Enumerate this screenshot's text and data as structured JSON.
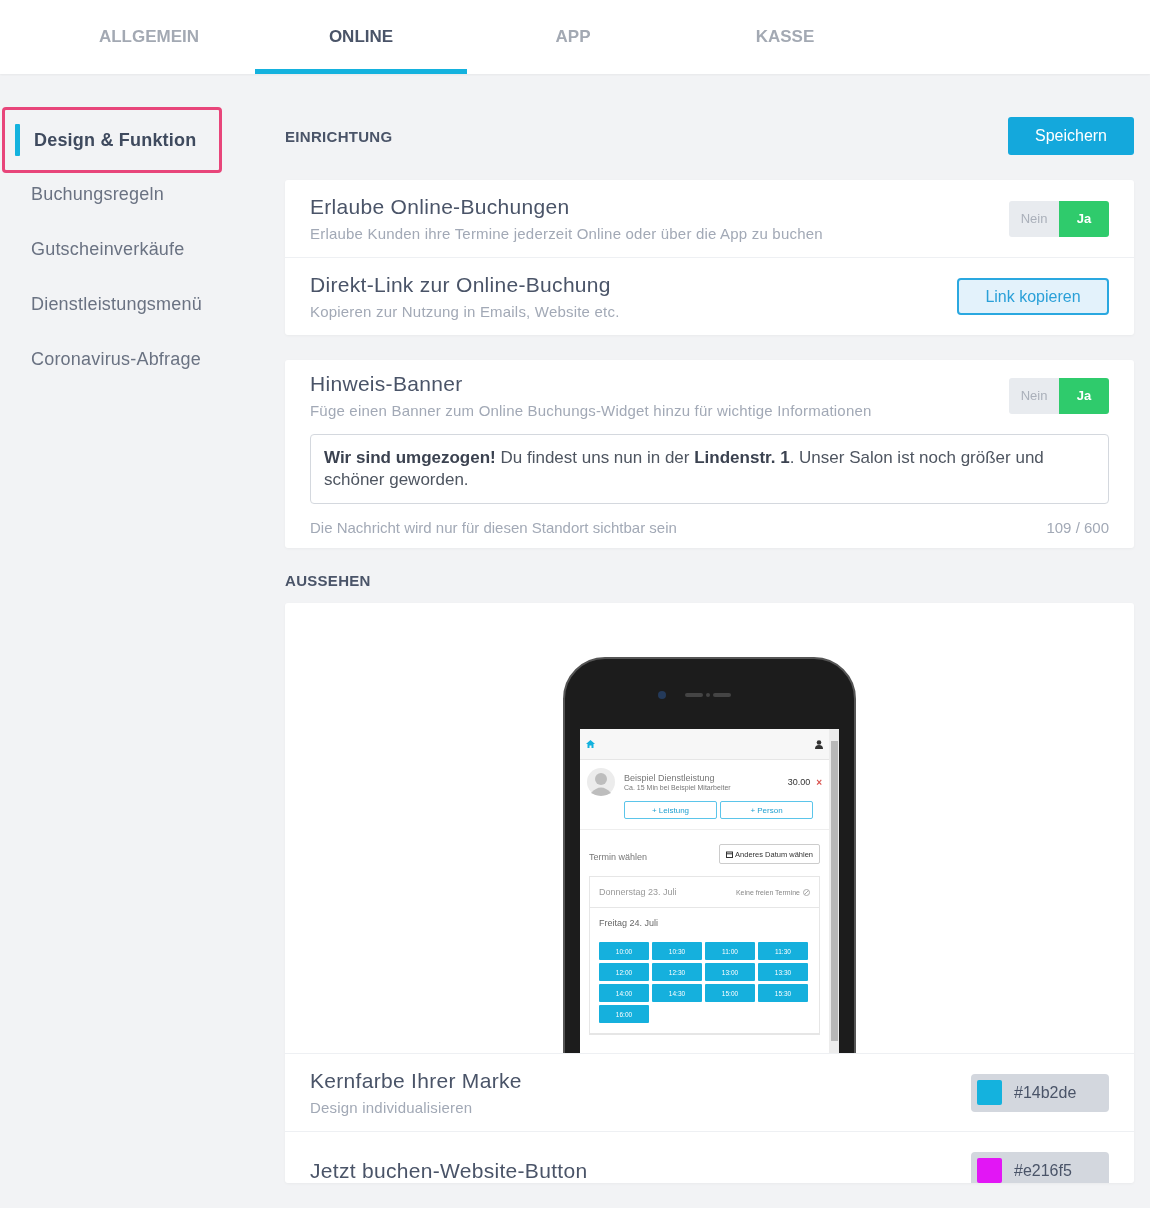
{
  "tabs": [
    {
      "label": "ALLGEMEIN",
      "selected": false
    },
    {
      "label": "ONLINE",
      "selected": true
    },
    {
      "label": "APP",
      "selected": false
    },
    {
      "label": "KASSE",
      "selected": false
    }
  ],
  "sidebar": {
    "items": [
      {
        "label": "Design & Funktion",
        "selected": true
      },
      {
        "label": "Buchungsregeln",
        "selected": false
      },
      {
        "label": "Gutscheinverkäufe",
        "selected": false
      },
      {
        "label": "Dienstleistungsmenü",
        "selected": false
      },
      {
        "label": "Coronavirus-Abfrage",
        "selected": false
      }
    ]
  },
  "einrichtung": {
    "heading": "EINRICHTUNG",
    "save_button": "Speichern",
    "rows": [
      {
        "kind": "toggle",
        "title": "Erlaube Online-Buchungen",
        "subtitle": "Erlaube Kunden ihre Termine jederzeit Online oder über die App zu buchen",
        "options": [
          {
            "label": "Nein",
            "selected": false
          },
          {
            "label": "Ja",
            "selected": true
          }
        ]
      },
      {
        "kind": "button",
        "title": "Direkt-Link zur Online-Buchung",
        "subtitle": "Kopieren zur Nutzung in Emails, Website etc.",
        "button": "Link kopieren"
      }
    ]
  },
  "banner": {
    "title": "Hinweis-Banner",
    "subtitle": "Füge einen Banner zum Online Buchungs-Widget hinzu für wichtige Informationen",
    "options": [
      {
        "label": "Nein",
        "selected": false
      },
      {
        "label": "Ja",
        "selected": true
      }
    ],
    "message": "**Wir sind umgezogen!** Du findest uns nun in der **Lindenstr. 1**. Unser Salon ist noch größer und schöner geworden.",
    "hint": "Die Nachricht wird nur für diesen Standort sichtbar sein",
    "counter": "109 / 600"
  },
  "aussehen": {
    "heading": "AUSSEHEN",
    "preview": {
      "service_name": "Beispiel Dienstleistung",
      "service_detail": "Ca. 15 Min bei Beispiel Mitarbeiter",
      "price": "30.00",
      "remove": "×",
      "add_buttons": [
        "+ Leistung",
        "+ Person"
      ],
      "termin_label": "Termin wählen",
      "other_date_button": "Anderes Datum wählen",
      "days": [
        {
          "label": "Donnerstag 23. Juli",
          "note": "Keine freien Termine",
          "disabled": true
        },
        {
          "label": "Freitag 24. Juli",
          "disabled": false,
          "slots": [
            "10:00",
            "10:30",
            "11:00",
            "11:30",
            "12:00",
            "12:30",
            "13:00",
            "13:30",
            "14:00",
            "14:30",
            "15:00",
            "15:30",
            "16:00"
          ]
        }
      ]
    },
    "colors": [
      {
        "title": "Kernfarbe Ihrer Marke",
        "subtitle": "Design individualisieren",
        "value": "#14b2de",
        "color": "#14b2de"
      },
      {
        "title": "Jetzt buchen-Website-Button",
        "value": "#e216f5",
        "color": "#e216f5"
      }
    ]
  }
}
